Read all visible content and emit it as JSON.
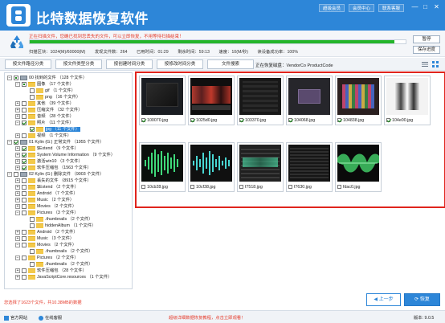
{
  "app": {
    "title": "比特数据恢复软件",
    "brand_color": "#2d86d8",
    "top_buttons": [
      "超级会员",
      "会员中心",
      "联系客服"
    ],
    "window_controls": [
      "—",
      "□",
      "✕"
    ]
  },
  "scan": {
    "message": "正在扫描文件，您确已找到您丢失的文件，可以立即恢复，不用等待扫描结束！",
    "progress_percent": 97,
    "stats": [
      "扫描区块：1024(M)/60000(M)",
      "发现文件数：264",
      "已用时间：01:29",
      "剩余时间：59:13",
      "速度：10(M/秒)",
      "读设备成功率：100%"
    ],
    "pause_label": "暂停",
    "save_progress_label": "保存进度"
  },
  "tabs": [
    "按文件路径分类",
    "按文件类型分类",
    "按创建时间分类",
    "按修改时间分类",
    "文件搜索"
  ],
  "path": {
    "label": "正在恢复磁盘：VendorCo ProductCode"
  },
  "tree": {
    "items": [
      {
        "text": "00 找到的文件  （128 个文件）"
      },
      {
        "text": "图像  （17 个文件）"
      },
      {
        "text": "gif  （1 个文件）"
      },
      {
        "text": "png  （16 个文件）"
      },
      {
        "text": "其他  （39 个文件）"
      },
      {
        "text": "压缩文件  （32 个文件）"
      },
      {
        "text": "音频  （28 个文件）"
      },
      {
        "text": "照片  （11 个文件）"
      },
      {
        "text": "jpg  （11 个文件）"
      },
      {
        "text": "视频  （1 个文件）"
      },
      {
        "text": "01 Kylin (G:) 正常文件  （1955 个文件）"
      },
      {
        "text": "$Extend  （9 个文件）"
      },
      {
        "text": "System Volume Information  （9 个文件）"
      },
      {
        "text": "激活win10  （3 个文件）"
      },
      {
        "text": "软件压缩包  （1563 个文件）"
      },
      {
        "text": "02 Kylin (G:) 删除文件  （9003 个文件）"
      },
      {
        "text": "丢失的文件  （8915 个文件）"
      },
      {
        "text": "$Extend  （2 个文件）"
      },
      {
        "text": "Android  （7 个文件）"
      },
      {
        "text": "Music  （2 个文件）"
      },
      {
        "text": "Movies  （2 个文件）"
      },
      {
        "text": "Pictures  （3 个文件）"
      },
      {
        "text": ".thumbnails  （2 个文件）"
      },
      {
        "text": "hiddenAlbum  （1 个文件）"
      },
      {
        "text": "Android  （2 个文件）"
      },
      {
        "text": "Music  （3 个文件）"
      },
      {
        "text": "Movies  （2 个文件）"
      },
      {
        "text": ".thumbnails  （2 个文件）"
      },
      {
        "text": "Pictures  （2 个文件）"
      },
      {
        "text": ".thumbnails  （2 个文件）"
      },
      {
        "text": "软件压缩包  （28 个文件）"
      },
      {
        "text": "JavaScriptCore.resources  （1 个文件）"
      }
    ]
  },
  "files": [
    {
      "name": "100070.jpg"
    },
    {
      "name": "1025d0.jpg"
    },
    {
      "name": "103370.jpg"
    },
    {
      "name": "104068.jpg"
    },
    {
      "name": "104838.jpg"
    },
    {
      "name": "104e00.jpg"
    },
    {
      "name": "10cb28.jpg"
    },
    {
      "name": "10cf38.jpg"
    },
    {
      "name": "f7518.jpg"
    },
    {
      "name": "f7630.jpg"
    },
    {
      "name": "fdac0.jpg"
    }
  ],
  "footer": {
    "selection_text": "您选择了1623个文件，共10.38MB的数据",
    "prev_label": "上一步",
    "recover_label": "恢复"
  },
  "statusbar": {
    "website": "官方网站",
    "online_support": "在线客服",
    "promo": "超级详细数据恢复教程，点击立即观看！",
    "version": "版本: 9.0.5"
  }
}
